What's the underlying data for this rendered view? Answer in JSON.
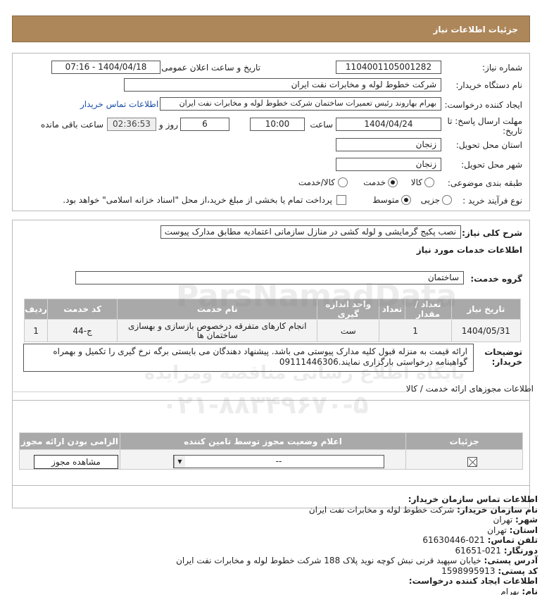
{
  "header": {
    "title": "جزئیات اطلاعات نیاز"
  },
  "form": {
    "need_number_label": "شماره نیاز:",
    "need_number": "1104001105001282",
    "announce_label": "تاریخ و ساعت اعلان عمومی:",
    "announce_value": "1404/04/18 - 07:16",
    "buyer_label": "نام دستگاه خریدار:",
    "buyer_value": "شرکت خطوط لوله و مخابرات نفت ایران",
    "creator_label": "ایجاد کننده درخواست:",
    "creator_value": "بهرام بهاروند رئیس تعمیرات ساختمان شرکت خطوط لوله و مخابرات نفت ایران",
    "buyer_contact_link": "اطلاعات تماس خریدار",
    "deadline_label": "مهلت ارسال پاسخ: تا تاریخ:",
    "deadline_date": "1404/04/24",
    "time_label": "ساعت",
    "deadline_time": "10:00",
    "days_value": "6",
    "days_label": "روز و",
    "remaining_time": "02:36:53",
    "remaining_label": "ساعت باقی مانده",
    "province_label": "استان محل تحویل:",
    "province_value": "زنجان",
    "city_label": "شهر محل تحویل:",
    "city_value": "زنجان",
    "category_label": "طبقه بندی موضوعی:",
    "category_options": [
      "کالا",
      "خدمت",
      "کالا/خدمت"
    ],
    "category_selected": "خدمت",
    "process_label": "نوع فرآیند خرید :",
    "process_options": [
      "جزیی",
      "متوسط"
    ],
    "process_selected": "متوسط",
    "payment_note": "پرداخت تمام یا بخشی از مبلغ خرید،از محل \"اسناد خزانه اسلامی\" خواهد بود."
  },
  "summary": {
    "label": "شرح کلی نیاز:",
    "value": "نصب پکیج گرمایشی و لوله کشی در منازل سازمانی اعتمادیه مطابق مدارک پیوست",
    "services_title": "اطلاعات خدمات مورد نیاز",
    "group_label": "گروه خدمت:",
    "group_value": "ساختمان"
  },
  "services_table": {
    "headers": [
      "ردیف",
      "کد خدمت",
      "نام خدمت",
      "واحد اندازه گیری",
      "تعداد / مقدار",
      "تاریخ نیاز"
    ],
    "rows": [
      {
        "index": "1",
        "code": "ج-44",
        "name": "انجام کارهای متفرقه درخصوص بازسازی و بهسازی ساختمان ها",
        "unit": "ست",
        "qty": "1",
        "date": "1404/05/31"
      }
    ]
  },
  "buyer_notes": {
    "label": "توضیحات خریدار:",
    "value": "ارائه قیمت به منزله قبول کلیه مدارک پیوستی می باشد. پیشنهاد دهندگان می بایستی برگه نرخ گیری را تکمیل و بهمراه گواهینامه درخواستی بارگزاری نمایند.09111446306"
  },
  "permits": {
    "title": "اطلاعات مجوزهای ارائه خدمت / کالا",
    "headers": [
      "الزامی بودن ارائه مجوز",
      "اعلام وضعیت مجوز توسط تامین کننده",
      "جزئیات"
    ],
    "status_value": "--",
    "view_button": "مشاهده مجوز"
  },
  "contact": {
    "title": "اطلاعات تماس سازمان خریدار:",
    "org_label": "نام سازمان خریدار:",
    "org_value": "شرکت خطوط لوله و مخابرات نفت ایران",
    "city_label": "شهر:",
    "city_value": "تهران",
    "province_label": "استان:",
    "province_value": "تهران",
    "phone_label": "تلفن تماس:",
    "phone_value": "021-61630446",
    "fax_label": "دورنگار:",
    "fax_value": "021-61651",
    "address_label": "آدرس پستی:",
    "address_value": "خیابان سپهبد قرنی نبش کوچه نوید پلاک 188 شرکت خطوط لوله و مخابرات نفت ایران",
    "postal_label": "کد پستی:",
    "postal_value": "1598995913",
    "creator_title": "اطلاعات ایجاد کننده درخواست:",
    "name_label": "نام:",
    "name_value": "بهرام"
  },
  "watermark": {
    "line1": "پایگاه اطلاع رسانی مناقصه ومزایده",
    "line2": "ParsNamadData",
    "line3": "۰۲۱-۸۸۳۴۹۶۷۰-۵"
  }
}
